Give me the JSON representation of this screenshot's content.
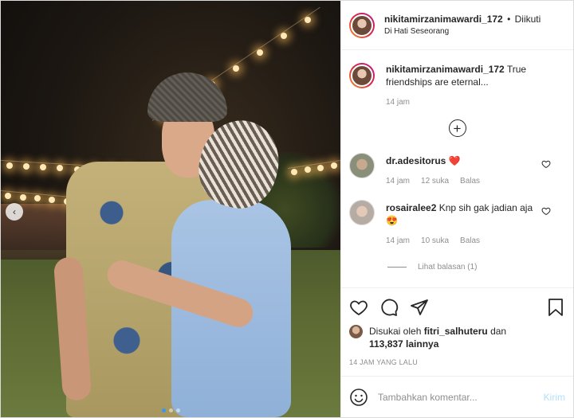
{
  "post": {
    "username": "nikitamirzanimawardi_172",
    "separator": "•",
    "follow_label": "Diikuti",
    "location": "Di Hati Seseorang",
    "caption": "True friendships are eternal...",
    "caption_time": "14 jam",
    "load_more_icon": "plus-circle-icon"
  },
  "comments": [
    {
      "username": "dr.adesitorus",
      "text": "",
      "emoji": "❤️",
      "time": "14 jam",
      "likes": "12 suka",
      "reply_label": "Balas"
    },
    {
      "username": "rosairalee2",
      "text": "Knp sih gak jadian aja",
      "emoji": "😍",
      "time": "14 jam",
      "likes": "10 suka",
      "reply_label": "Balas",
      "view_replies": "Lihat balasan (1)"
    }
  ],
  "likes": {
    "prefix": "Disukai oleh",
    "user": "fitri_salhuteru",
    "and": "dan",
    "count": "113,837 lainnya"
  },
  "timeago": "14 JAM YANG LALU",
  "add_comment": {
    "placeholder": "Tambahkan komentar...",
    "post_label": "Kirim"
  },
  "carousel": {
    "prev_glyph": "‹",
    "slides": 3,
    "active_slide": 1
  },
  "colors": {
    "accent": "#3897f0",
    "heart": "#ed4956",
    "post_disabled": "#b2dffc",
    "muted": "#8e8e8e"
  }
}
